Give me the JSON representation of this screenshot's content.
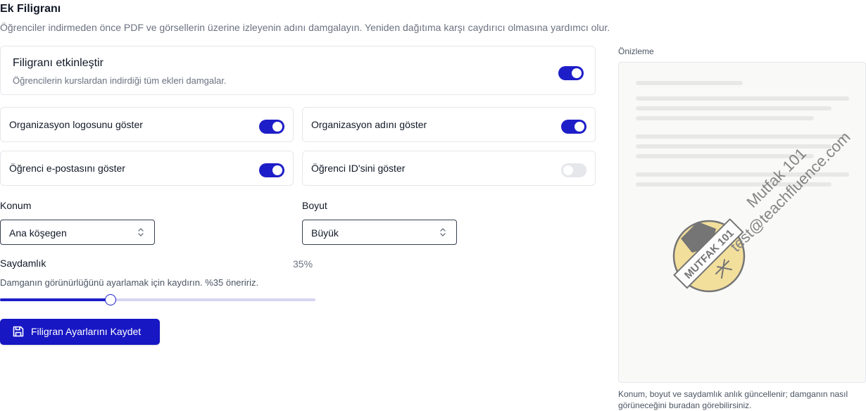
{
  "header": {
    "title": "Ek Filigranı",
    "subtitle": "Öğrenciler indirmeden önce PDF ve görsellerin üzerine izleyenin adını damgalayın. Yeniden dağıtıma karşı caydırıcı olmasına yardımcı olur."
  },
  "enable": {
    "title": "Filigranı etkinleştir",
    "description": "Öğrencilerin kurslardan indirdiği tüm ekleri damgalar.",
    "on": true
  },
  "options": [
    {
      "label": "Organizasyon logosunu göster",
      "on": true
    },
    {
      "label": "Organizasyon adını göster",
      "on": true
    },
    {
      "label": "Öğrenci e-postasını göster",
      "on": true
    },
    {
      "label": "Öğrenci ID'sini göster",
      "on": false
    }
  ],
  "position": {
    "label": "Konum",
    "value": "Ana köşegen"
  },
  "size": {
    "label": "Boyut",
    "value": "Büyük"
  },
  "opacity": {
    "label": "Saydamlık",
    "value_text": "35%",
    "help": "Damganın görünürlüğünü ayarlamak için kaydırın. %35 öneririz.",
    "value": 0.35
  },
  "save_button": {
    "label": "Filigran Ayarlarını Kaydet",
    "icon": "save-icon"
  },
  "preview": {
    "label": "Önizleme",
    "watermark_org": "Mutfak 101",
    "watermark_email": "test@teachfluence.com",
    "logo_text": "MUTFAK 101",
    "caption": "Konum, boyut ve saydamlık anlık güncellenir; damganın nasıl görüneceğini buradan görebilirsiniz."
  },
  "colors": {
    "accent": "#1717c4",
    "toggle_off": "#e5e7eb",
    "logo_fill": "#f1d77e",
    "logo_dark": "#4a4a4a"
  }
}
